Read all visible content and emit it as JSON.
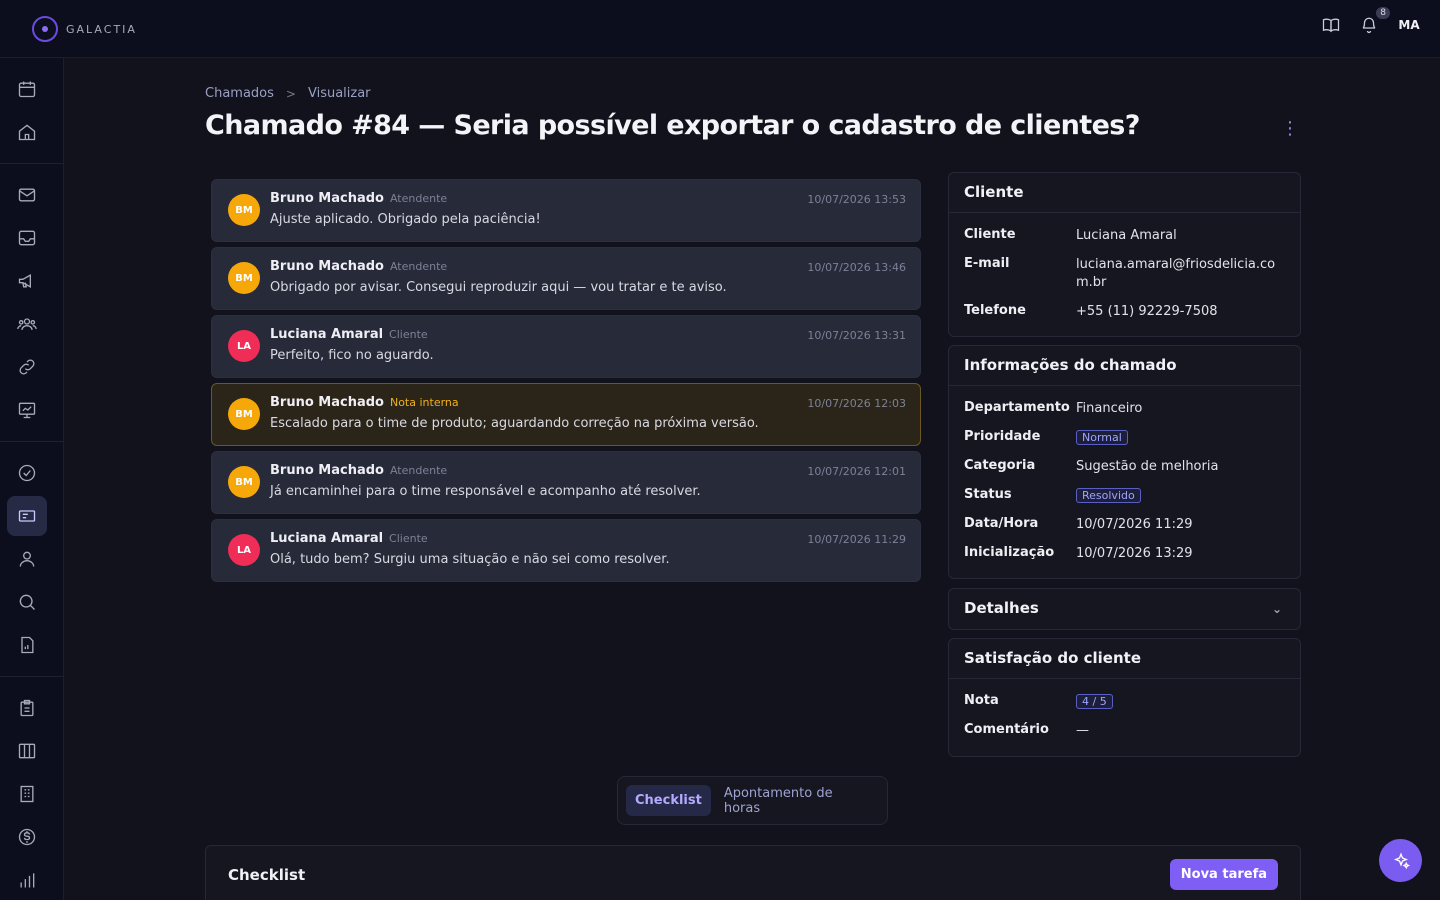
{
  "app": {
    "name": "GALACTIA"
  },
  "topbar": {
    "notifications": "8",
    "user_initials": "MA"
  },
  "breadcrumb": {
    "root": "Chamados",
    "current": "Visualizar"
  },
  "page": {
    "title": "Chamado #84 — Seria possível exportar o cadastro de clientes?"
  },
  "messages": [
    {
      "initials": "BM",
      "name": "Bruno Machado",
      "role": "Atendente",
      "time": "10/07/2026 13:53",
      "text": "Ajuste aplicado. Obrigado pela paciência!"
    },
    {
      "initials": "BM",
      "name": "Bruno Machado",
      "role": "Atendente",
      "time": "10/07/2026 13:46",
      "text": "Obrigado por avisar. Consegui reproduzir aqui — vou tratar e te aviso."
    },
    {
      "initials": "LA",
      "name": "Luciana Amaral",
      "role": "Cliente",
      "time": "10/07/2026 13:31",
      "text": "Perfeito, fico no aguardo."
    },
    {
      "initials": "BM",
      "name": "Bruno Machado",
      "role": "Nota interna",
      "time": "10/07/2026 12:03",
      "text": "Escalado para o time de produto; aguardando correção na próxima versão."
    },
    {
      "initials": "BM",
      "name": "Bruno Machado",
      "role": "Atendente",
      "time": "10/07/2026 12:01",
      "text": "Já encaminhei para o time responsável e acompanho até resolver."
    },
    {
      "initials": "LA",
      "name": "Luciana Amaral",
      "role": "Cliente",
      "time": "10/07/2026 11:29",
      "text": "Olá, tudo bem? Surgiu uma situação e não sei como resolver."
    }
  ],
  "client_panel": {
    "title": "Cliente",
    "fields": [
      {
        "k": "Cliente",
        "v": "Luciana Amaral"
      },
      {
        "k": "E-mail",
        "v": "luciana.amaral@friosdelicia.com.br"
      },
      {
        "k": "Telefone",
        "v": "+55 (11) 92229-7508"
      }
    ]
  },
  "ticket_panel": {
    "title": "Informações do chamado",
    "fields": [
      {
        "k": "Departamento",
        "v": "Financeiro"
      },
      {
        "k": "Prioridade",
        "v": "Normal"
      },
      {
        "k": "Categoria",
        "v": "Sugestão de melhoria"
      },
      {
        "k": "Status",
        "v": "Resolvido"
      },
      {
        "k": "Data/Hora",
        "v": "10/07/2026 11:29"
      },
      {
        "k": "Inicialização",
        "v": "10/07/2026 13:29"
      }
    ]
  },
  "details_panel": {
    "title": "Detalhes"
  },
  "satisfaction_panel": {
    "title": "Satisfação do cliente",
    "fields": [
      {
        "k": "Nota",
        "v": "4 / 5"
      },
      {
        "k": "Comentário",
        "v": "—"
      }
    ]
  },
  "tabs": [
    {
      "label": "Checklist"
    },
    {
      "label": "Apontamento de horas"
    }
  ],
  "checklist": {
    "title": "Checklist",
    "new_task_label": "Nova tarefa"
  },
  "colors": {
    "accent": "#7f5ef5",
    "attendant_avatar": "#f6a80a",
    "client_avatar": "#ef2d56",
    "internal_note": "#f2b01a"
  }
}
